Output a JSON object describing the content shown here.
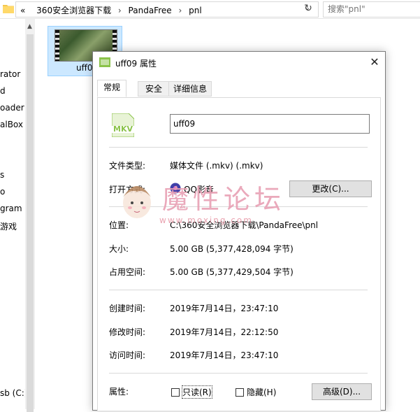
{
  "explorer": {
    "path": [
      "«",
      "360安全浏览器下载",
      "PandaFree",
      "pnl"
    ],
    "search_placeholder": "搜索\"pnl\"",
    "nav_items": [
      "rator",
      "d",
      "oader",
      "alBox",
      "s",
      "o",
      "gram",
      "游戏",
      "sb (C:)"
    ],
    "file_name": "uff09"
  },
  "dialog": {
    "title": "uff09 属性",
    "close_glyph": "✕",
    "tabs": [
      "常规",
      "安全",
      "详细信息"
    ],
    "file_icon_text": "MKV",
    "file_name_value": "uff09",
    "file_type_label": "文件类型:",
    "file_type_value": "媒体文件 (.mkv) (.mkv)",
    "open_with_label": "打开方式:",
    "open_with_value": "QQ影音",
    "change_button": "更改(C)...",
    "location_label": "位置:",
    "location_value": "C:\\360安全浏览器下载\\PandaFree\\pnl",
    "size_label": "大小:",
    "size_value": "5.00 GB (5,377,428,094 字节)",
    "size_on_disk_label": "占用空间:",
    "size_on_disk_value": "5.00 GB (5,377,429,504 字节)",
    "created_label": "创建时间:",
    "created_value": "2019年7月14日，23:47:10",
    "modified_label": "修改时间:",
    "modified_value": "2019年7月14日，22:12:50",
    "accessed_label": "访问时间:",
    "accessed_value": "2019年7月14日，23:47:10",
    "attributes_label": "属性:",
    "readonly_label": "只读(R)",
    "hidden_label": "隐藏(H)",
    "advanced_button": "高级(D)..."
  },
  "watermark": {
    "text": "魔性论坛",
    "url": "www.moxing.com"
  },
  "colors": {
    "selection_bg": "#cce8ff",
    "mkv_green": "#8bc34a",
    "watermark_pink": "#e8a0b4"
  }
}
